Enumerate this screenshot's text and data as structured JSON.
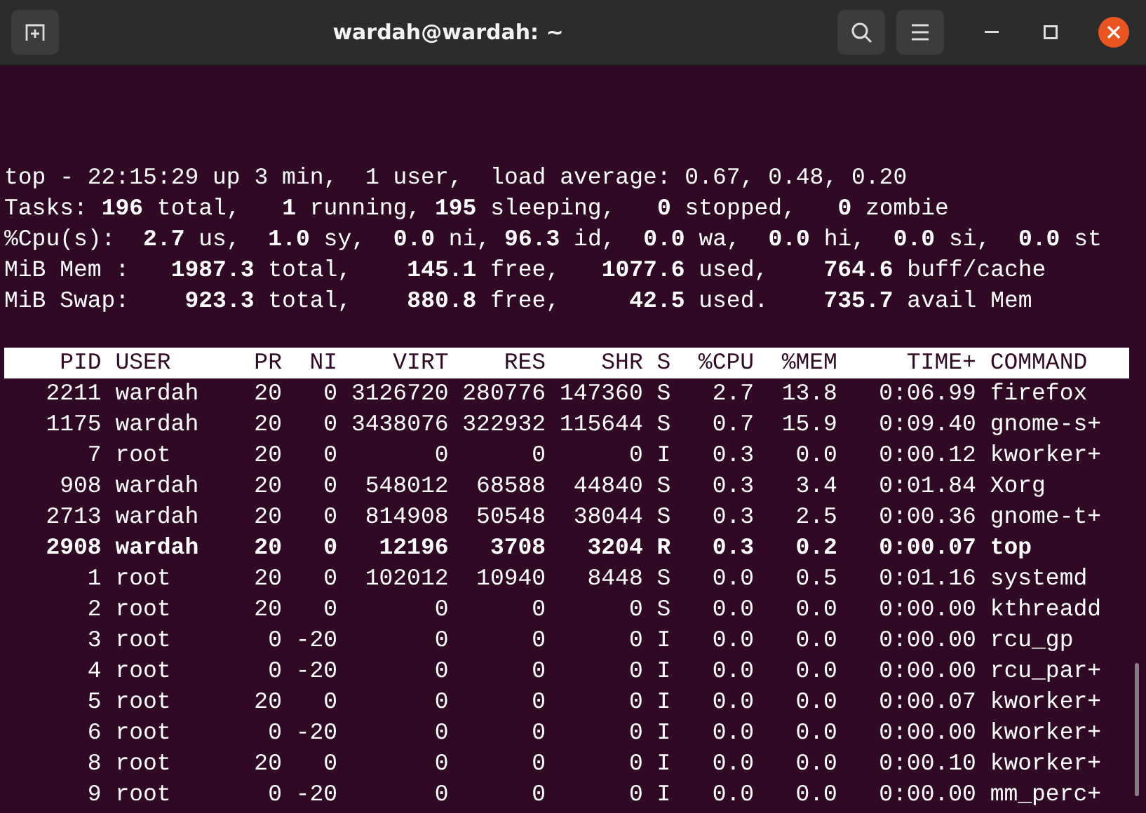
{
  "window": {
    "title": "wardah@wardah: ~"
  },
  "summary": [
    "top - 22:15:29 up 3 min,  1 user,  load average: 0.67, 0.48, 0.20",
    "Tasks: **196** total,   **1** running, **195** sleeping,   **0** stopped,   **0** zombie",
    "%Cpu(s):  **2.7** us,  **1.0** sy,  **0.0** ni, **96.3** id,  **0.0** wa,  **0.0** hi,  **0.0** si,  **0.0** st",
    "MiB Mem :   **1987.3** total,    **145.1** free,   **1077.6** used,    **764.6** buff/cache",
    "MiB Swap:    **923.3** total,    **880.8** free,     **42.5** used.    **735.7** avail Mem"
  ],
  "table": {
    "columns": [
      "PID",
      "USER",
      "PR",
      "NI",
      "VIRT",
      "RES",
      "SHR",
      "S",
      "%CPU",
      "%MEM",
      "TIME+",
      "COMMAND"
    ],
    "rows": [
      {
        "bold": false,
        "cells": [
          "2211",
          "wardah",
          "20",
          "0",
          "3126720",
          "280776",
          "147360",
          "S",
          "2.7",
          "13.8",
          "0:06.99",
          "firefox"
        ]
      },
      {
        "bold": false,
        "cells": [
          "1175",
          "wardah",
          "20",
          "0",
          "3438076",
          "322932",
          "115644",
          "S",
          "0.7",
          "15.9",
          "0:09.40",
          "gnome-s+"
        ]
      },
      {
        "bold": false,
        "cells": [
          "7",
          "root",
          "20",
          "0",
          "0",
          "0",
          "0",
          "I",
          "0.3",
          "0.0",
          "0:00.12",
          "kworker+"
        ]
      },
      {
        "bold": false,
        "cells": [
          "908",
          "wardah",
          "20",
          "0",
          "548012",
          "68588",
          "44840",
          "S",
          "0.3",
          "3.4",
          "0:01.84",
          "Xorg"
        ]
      },
      {
        "bold": false,
        "cells": [
          "2713",
          "wardah",
          "20",
          "0",
          "814908",
          "50548",
          "38044",
          "S",
          "0.3",
          "2.5",
          "0:00.36",
          "gnome-t+"
        ]
      },
      {
        "bold": true,
        "cells": [
          "2908",
          "wardah",
          "20",
          "0",
          "12196",
          "3708",
          "3204",
          "R",
          "0.3",
          "0.2",
          "0:00.07",
          "top"
        ]
      },
      {
        "bold": false,
        "cells": [
          "1",
          "root",
          "20",
          "0",
          "102012",
          "10940",
          "8448",
          "S",
          "0.0",
          "0.5",
          "0:01.16",
          "systemd"
        ]
      },
      {
        "bold": false,
        "cells": [
          "2",
          "root",
          "20",
          "0",
          "0",
          "0",
          "0",
          "S",
          "0.0",
          "0.0",
          "0:00.00",
          "kthreadd"
        ]
      },
      {
        "bold": false,
        "cells": [
          "3",
          "root",
          "0",
          "-20",
          "0",
          "0",
          "0",
          "I",
          "0.0",
          "0.0",
          "0:00.00",
          "rcu_gp"
        ]
      },
      {
        "bold": false,
        "cells": [
          "4",
          "root",
          "0",
          "-20",
          "0",
          "0",
          "0",
          "I",
          "0.0",
          "0.0",
          "0:00.00",
          "rcu_par+"
        ]
      },
      {
        "bold": false,
        "cells": [
          "5",
          "root",
          "20",
          "0",
          "0",
          "0",
          "0",
          "I",
          "0.0",
          "0.0",
          "0:00.07",
          "kworker+"
        ]
      },
      {
        "bold": false,
        "cells": [
          "6",
          "root",
          "0",
          "-20",
          "0",
          "0",
          "0",
          "I",
          "0.0",
          "0.0",
          "0:00.00",
          "kworker+"
        ]
      },
      {
        "bold": false,
        "cells": [
          "8",
          "root",
          "20",
          "0",
          "0",
          "0",
          "0",
          "I",
          "0.0",
          "0.0",
          "0:00.10",
          "kworker+"
        ]
      },
      {
        "bold": false,
        "cells": [
          "9",
          "root",
          "0",
          "-20",
          "0",
          "0",
          "0",
          "I",
          "0.0",
          "0.0",
          "0:00.00",
          "mm_perc+"
        ]
      }
    ]
  }
}
